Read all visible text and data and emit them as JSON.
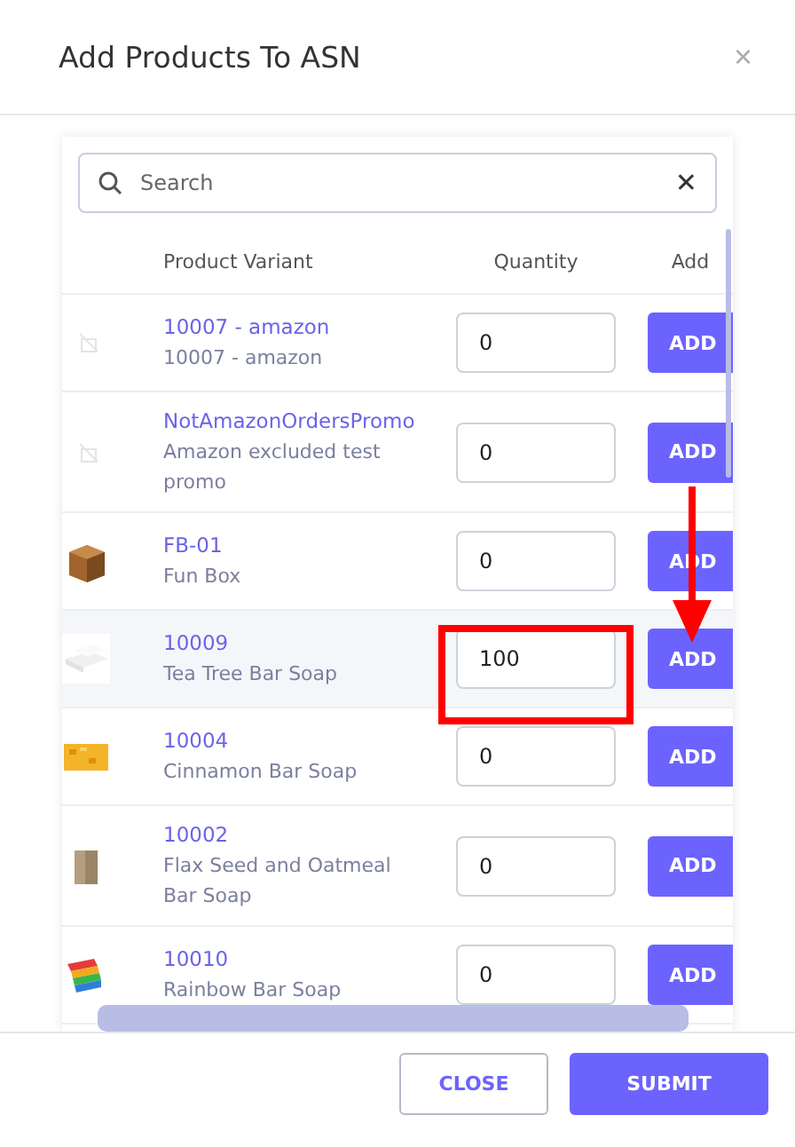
{
  "dialog": {
    "title": "Add Products To ASN",
    "close_icon": "×"
  },
  "search": {
    "placeholder": "Search",
    "clear_icon": "✕"
  },
  "table": {
    "columns": [
      "Product Variant",
      "Quantity",
      "Add"
    ],
    "rows": [
      {
        "kind": "placeholder",
        "sku": "10007 - amazon",
        "name": "10007 - amazon",
        "quantity": "0",
        "button": "ADD",
        "highlighted": false
      },
      {
        "kind": "placeholder",
        "sku": "NotAmazonOrdersPromo",
        "name": "Amazon excluded test promo",
        "quantity": "0",
        "button": "ADD",
        "highlighted": false
      },
      {
        "kind": "picture",
        "sku": "FB-01",
        "name": "Fun Box",
        "quantity": "0",
        "button": "ADD",
        "highlighted": false
      },
      {
        "kind": "picture",
        "sku": "10009",
        "name": "Tea Tree Bar Soap",
        "quantity": "100",
        "button": "ADD",
        "highlighted": true
      },
      {
        "kind": "picture",
        "sku": "10004",
        "name": "Cinnamon Bar Soap",
        "quantity": "0",
        "button": "ADD",
        "highlighted": false
      },
      {
        "kind": "picture",
        "sku": "10002",
        "name": "Flax Seed and Oatmeal Bar Soap",
        "quantity": "0",
        "button": "ADD",
        "highlighted": false
      },
      {
        "kind": "picture",
        "sku": "10010",
        "name": "Rainbow Bar Soap",
        "quantity": "0",
        "button": "ADD",
        "highlighted": false
      }
    ]
  },
  "footer": {
    "buttons": [
      {
        "label": "CLOSE",
        "kind": "secondary"
      },
      {
        "label": "SUBMIT",
        "kind": "primary"
      }
    ]
  }
}
